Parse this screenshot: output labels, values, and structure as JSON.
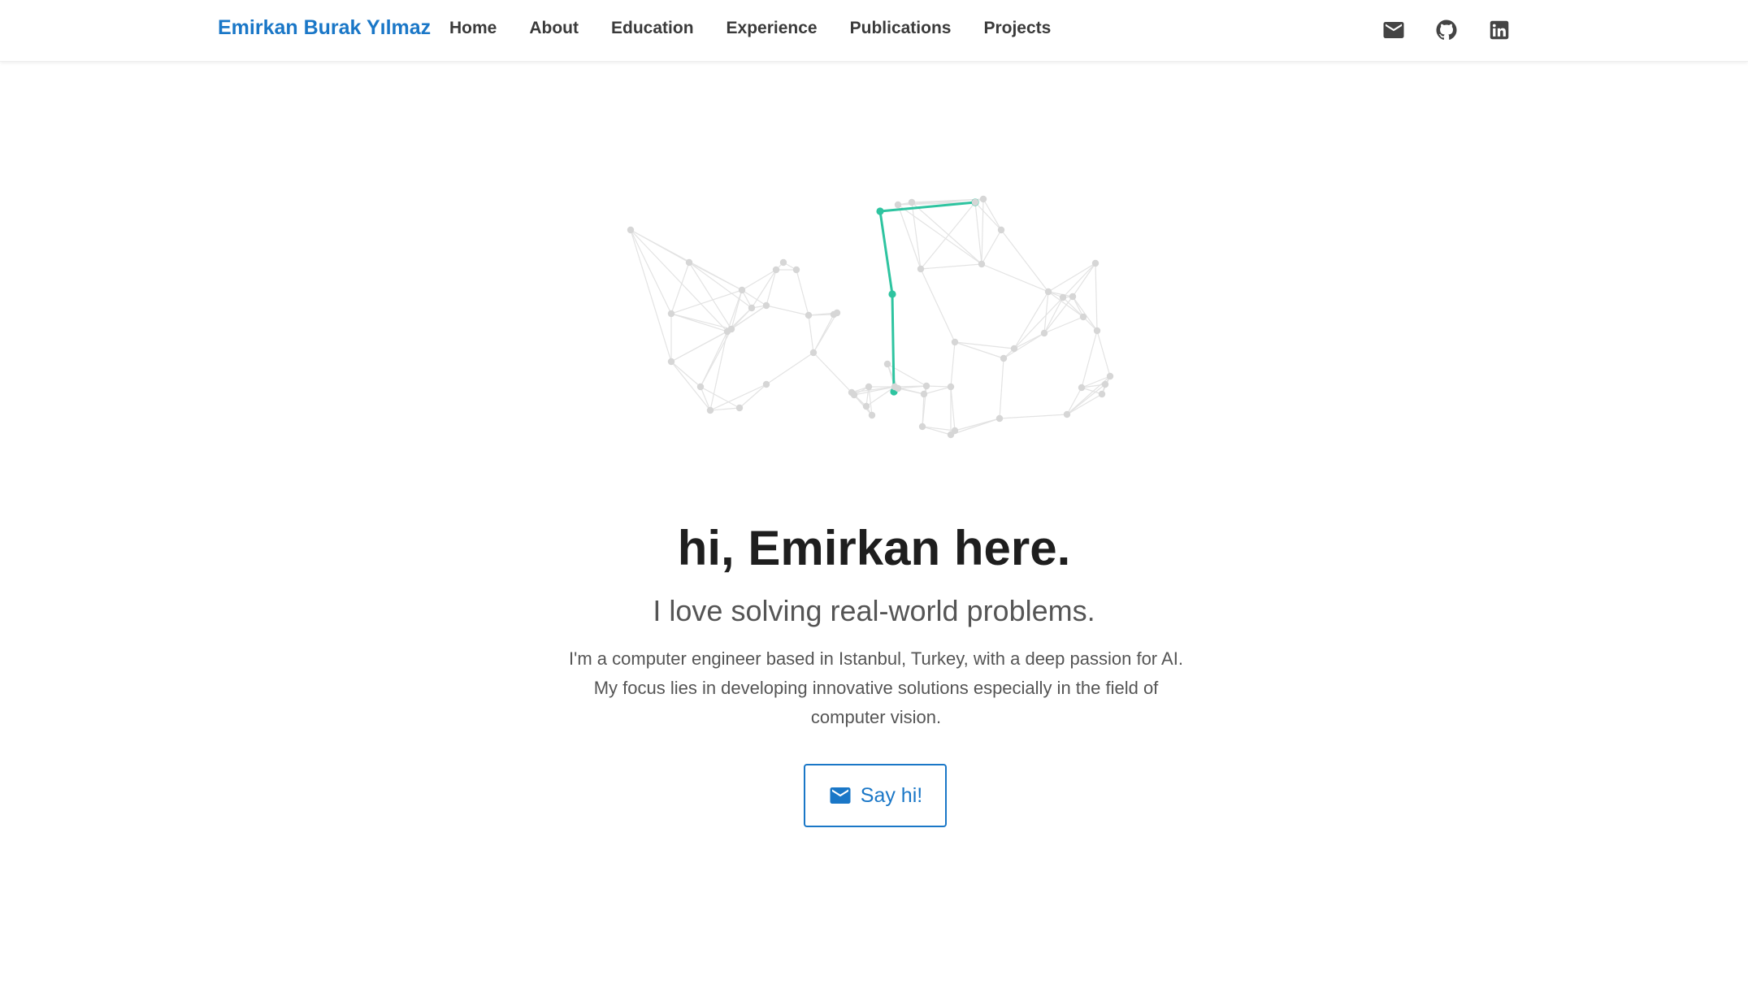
{
  "nav": {
    "brand": "Emirkan Burak Yılmaz",
    "links": [
      "Home",
      "About",
      "Education",
      "Experience",
      "Publications",
      "Projects"
    ],
    "icons": [
      "email-icon",
      "github-icon",
      "linkedin-icon"
    ]
  },
  "hero": {
    "title": "hi, Emirkan here.",
    "subtitle": "I love solving real-world problems.",
    "description": "I'm a computer engineer based in Istanbul, Turkey, with a deep passion for AI. My focus lies in developing innovative solutions especially in the field of computer vision.",
    "cta_label": "Say hi!"
  },
  "colors": {
    "brand": "#1a77c7",
    "accent_path": "#2ec4a0",
    "node": "#d6d6d6",
    "edge": "#e3e3e3"
  }
}
